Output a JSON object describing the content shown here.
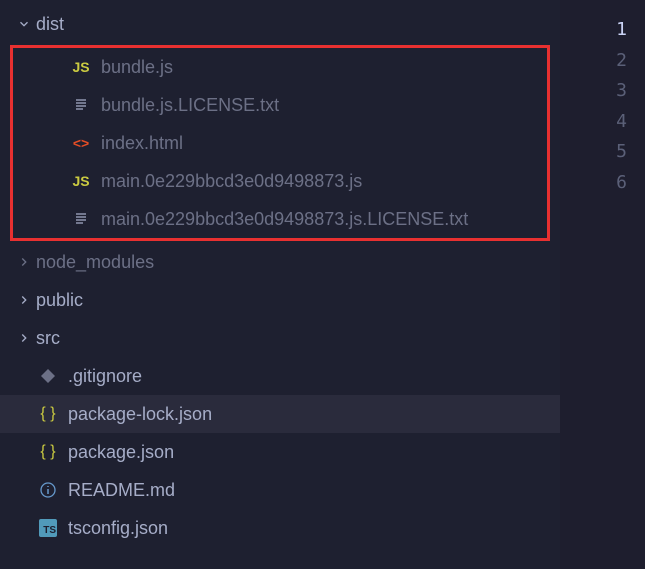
{
  "sidebar": {
    "folders": {
      "dist": {
        "name": "dist",
        "expanded": true
      },
      "node_modules": {
        "name": "node_modules",
        "expanded": false
      },
      "public": {
        "name": "public",
        "expanded": false
      },
      "src": {
        "name": "src",
        "expanded": false
      }
    },
    "dist_files": [
      {
        "type": "js",
        "name": "bundle.js"
      },
      {
        "type": "txt",
        "name": "bundle.js.LICENSE.txt"
      },
      {
        "type": "html",
        "name": "index.html"
      },
      {
        "type": "js",
        "name": "main.0e229bbcd3e0d9498873.js"
      },
      {
        "type": "txt",
        "name": "main.0e229bbcd3e0d9498873.js.LICENSE.txt"
      }
    ],
    "root_files": [
      {
        "type": "git",
        "name": ".gitignore"
      },
      {
        "type": "json",
        "name": "package-lock.json",
        "selected": true
      },
      {
        "type": "json",
        "name": "package.json"
      },
      {
        "type": "info",
        "name": "README.md"
      },
      {
        "type": "ts",
        "name": "tsconfig.json"
      }
    ]
  },
  "editor": {
    "line_numbers": [
      "1",
      "2",
      "3",
      "4",
      "5",
      "6"
    ],
    "active_line": 1
  },
  "icons": {
    "js": "JS",
    "html": "<>",
    "ts": "TS"
  }
}
